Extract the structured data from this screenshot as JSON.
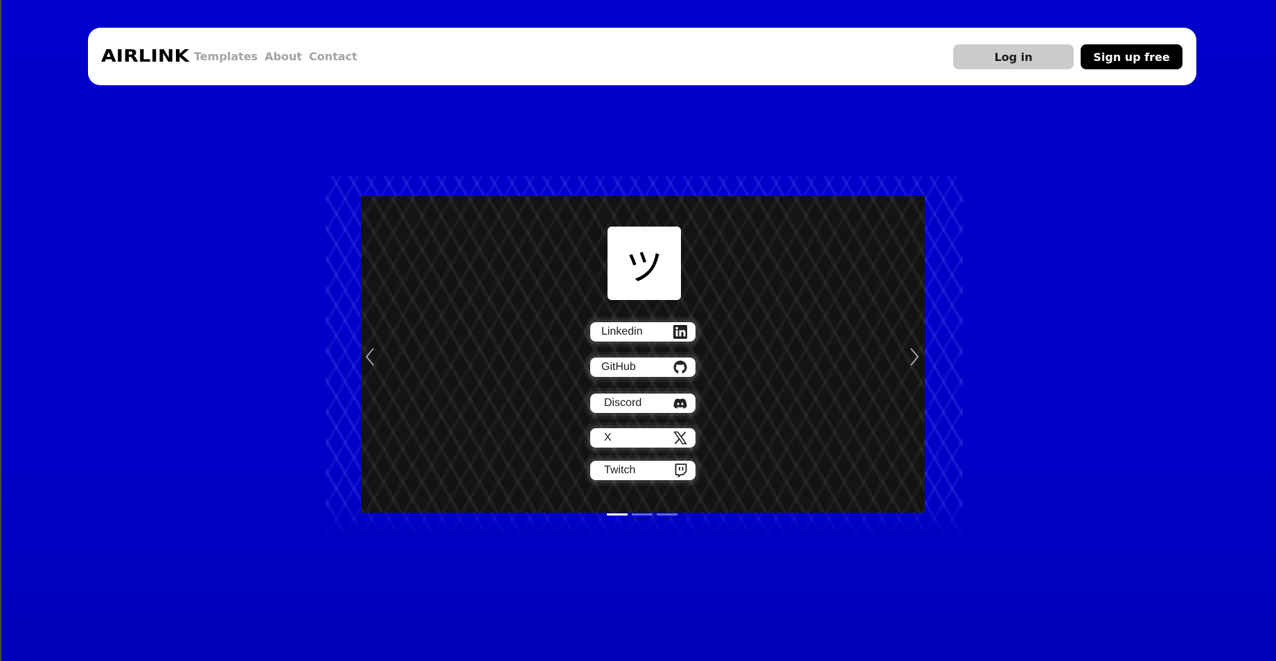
{
  "nav": {
    "logo": "AIRLINK",
    "links": [
      {
        "label": "Templates"
      },
      {
        "label": "About"
      },
      {
        "label": "Contact"
      }
    ],
    "login_label": "Log in",
    "signup_label": "Sign up free"
  },
  "carousel": {
    "profile": {
      "avatar_glyph": "ツ"
    },
    "links": [
      {
        "label": "Linkedin",
        "icon": "linkedin-icon"
      },
      {
        "label": "GitHub",
        "icon": "github-icon"
      },
      {
        "label": "Discord",
        "icon": "discord-icon"
      },
      {
        "label": "X",
        "icon": "x-icon"
      },
      {
        "label": "Twitch",
        "icon": "twitch-icon"
      }
    ],
    "slide_count": 3,
    "active_slide": 1
  },
  "colors": {
    "background": "#0000cc",
    "slide_background": "#131313",
    "accent_dark": "#000000",
    "login_button": "#cccccc"
  }
}
